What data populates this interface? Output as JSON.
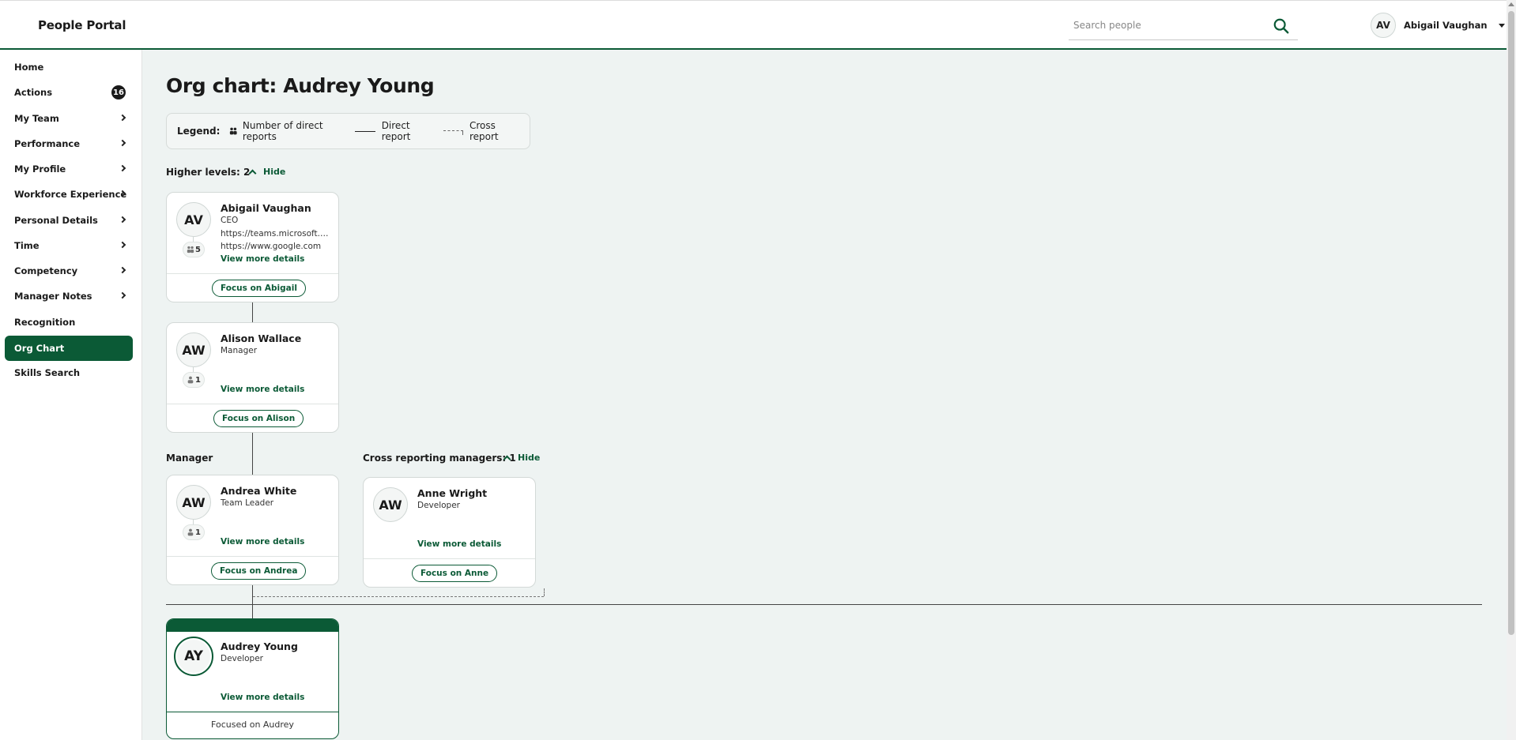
{
  "header": {
    "brand": "People Portal",
    "search_placeholder": "Search people",
    "user_initials": "AV",
    "user_name": "Abigail Vaughan"
  },
  "sidebar": {
    "items": [
      {
        "label": "Home"
      },
      {
        "label": "Actions",
        "badge": "16"
      },
      {
        "label": "My Team"
      },
      {
        "label": "Performance"
      },
      {
        "label": "My Profile"
      },
      {
        "label": "Workforce Experience"
      },
      {
        "label": "Personal Details"
      },
      {
        "label": "Time"
      },
      {
        "label": "Competency"
      },
      {
        "label": "Manager Notes"
      },
      {
        "label": "Recognition"
      },
      {
        "label": "Org Chart"
      },
      {
        "label": "Skills Search"
      }
    ]
  },
  "main": {
    "title": "Org chart: Audrey Young",
    "legend": {
      "label": "Legend:",
      "reports": "Number of direct reports",
      "direct": "Direct report",
      "cross": "Cross report"
    },
    "higher_levels": "Higher levels: 2",
    "hide": "Hide",
    "manager_label": "Manager",
    "cross_label": "Cross reporting managers: 1",
    "view_more": "View more details",
    "cards": {
      "abigail": {
        "initials": "AV",
        "name": "Abigail Vaughan",
        "role": "CEO",
        "reports": "5",
        "link1": "https://teams.microsoft.com/l/chat",
        "link2": "https://www.google.com",
        "focus": "Focus on Abigail"
      },
      "alison": {
        "initials": "AW",
        "name": "Alison Wallace",
        "role": "Manager",
        "reports": "1",
        "focus": "Focus on Alison"
      },
      "andrea": {
        "initials": "AW",
        "name": "Andrea White",
        "role": "Team Leader",
        "reports": "1",
        "focus": "Focus on Andrea"
      },
      "anne": {
        "initials": "AW",
        "name": "Anne Wright",
        "role": "Developer",
        "focus": "Focus on Anne"
      },
      "audrey": {
        "initials": "AY",
        "name": "Audrey Young",
        "role": "Developer",
        "focused": "Focused on Audrey"
      }
    }
  },
  "colors": {
    "accent": "#0b5a36",
    "background": "#eef3f2"
  }
}
